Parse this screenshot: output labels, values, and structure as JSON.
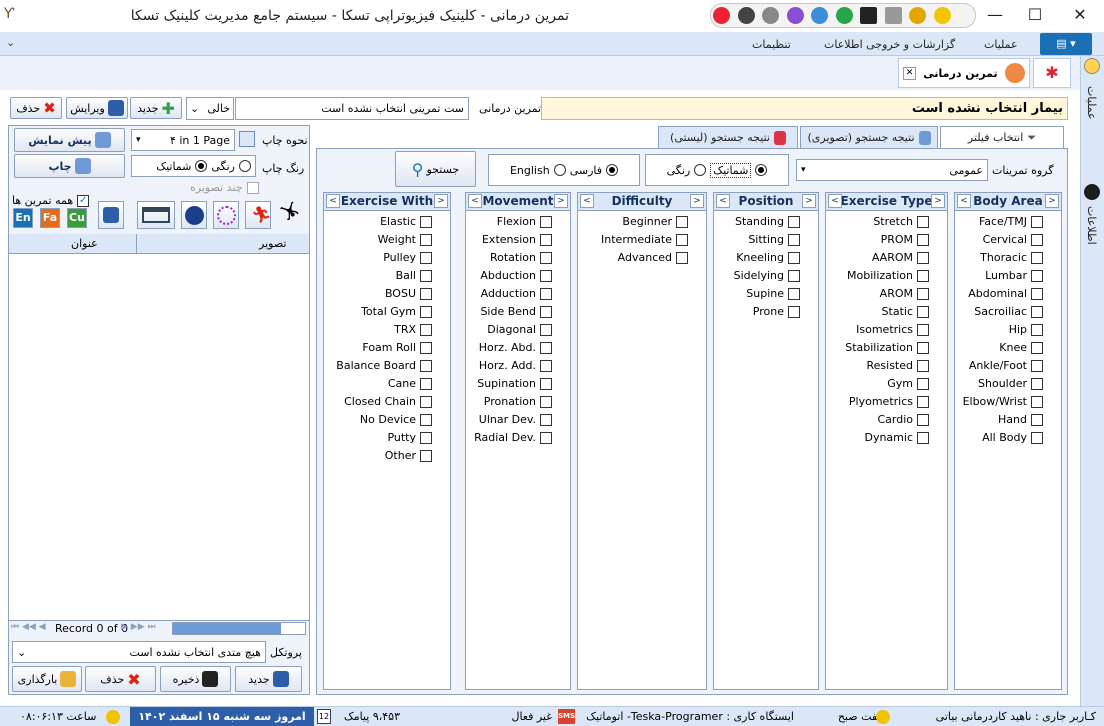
{
  "window": {
    "title": "تمرین درمانی - کلینیک فیزیوتراپی تسکا - سیستم جامع مدیریت کلینیک تسکا",
    "minimize": "—",
    "maximize": "☐",
    "close": "✕"
  },
  "menu": {
    "operations": "عملیات",
    "reports": "گزارشات و خروجی اطلاعات",
    "settings": "تنظیمات"
  },
  "doc_tab": {
    "label": "تمرین درمانی",
    "close": "✕"
  },
  "side_right": {
    "operations": "عملیات",
    "info": "اطلاعات"
  },
  "toolbar": {
    "patient_status": "بیمار انتخاب نشده است",
    "exercise_label": "تمرین درمانی",
    "exercise_value": "ست تمرینی انتخاب نشده است",
    "filter_value": "خالی",
    "new_label": "جدید",
    "edit_label": "ویرایش",
    "delete_label": "حذف"
  },
  "left": {
    "print_mode_label": "نحوه چاپ",
    "print_mode_value": "۴ in 1 Page",
    "preview_button": "پیش نمایش",
    "print_color_label": "رنگ چاپ",
    "color_option": "رنگی",
    "schematic_option": "شماتیک",
    "print_button": "چاپ",
    "multi_image": "چند تصویره",
    "all_exercises": "همه تمرین ها",
    "lang_en": "En",
    "lang_fa": "Fa",
    "lang_cu": "Cu",
    "col_title": "عنوان",
    "col_image": "تصویر",
    "record_text": "Record 0 of 0",
    "protocol_label": "پروتکل",
    "protocol_value": "هیچ متدی انتخاب نشده است",
    "new_btn": "جدید",
    "save_btn": "ذخیره",
    "delete_btn": "حذف",
    "load_btn": "بارگذاری"
  },
  "tabs": {
    "filter": "انتخاب فیلتر",
    "image_result": "(نتیجه جستجو (تصویری",
    "list_result": "(نتیجه جستجو (لیستی"
  },
  "filter": {
    "group_label": "گروه تمرینات",
    "group_value": "عمومی",
    "color_option": "رنگی",
    "schematic_option": "شماتیک",
    "lang_english": "English",
    "lang_farsi": "فارسی",
    "search_button": "جستجو"
  },
  "columns": [
    {
      "title": "Body Area",
      "items": [
        "Face/TMJ",
        "Cervical",
        "Thoracic",
        "Lumbar",
        "Abdominal",
        "Sacroiliac",
        "Hip",
        "Knee",
        "Ankle/Foot",
        "Shoulder",
        "Elbow/Wrist",
        "Hand",
        "All Body"
      ]
    },
    {
      "title": "Exercise Type",
      "items": [
        "Stretch",
        "PROM",
        "AAROM",
        "Mobilization",
        "AROM",
        "Static",
        "Isometrics",
        "Stabilization",
        "Resisted",
        "Gym",
        "Plyometrics",
        "Cardio",
        "Dynamic"
      ]
    },
    {
      "title": "Position",
      "items": [
        "Standing",
        "Sitting",
        "Kneeling",
        "Sidelying",
        "Supine",
        "Prone"
      ]
    },
    {
      "title": "Difficulty",
      "items": [
        "Beginner",
        "Intermediate",
        "Advanced"
      ]
    },
    {
      "title": "Movement",
      "items": [
        "Flexion",
        "Extension",
        "Rotation",
        "Abduction",
        "Adduction",
        "Side Bend",
        "Diagonal",
        "Horz. Abd.",
        "Horz. Add.",
        "Supination",
        "Pronation",
        "Ulnar Dev.",
        "Radial Dev."
      ]
    },
    {
      "title": "Exercise With",
      "items": [
        "Elastic",
        "Weight",
        "Pulley",
        "Ball",
        "BOSU",
        "Total Gym",
        "TRX",
        "Foam Roll",
        "Balance Board",
        "Cane",
        "Closed Chain",
        "No Device",
        "Putty",
        "Other"
      ]
    }
  ],
  "status": {
    "user": "کـاربر جاری : ناهید کاردرمانی بیاتی",
    "shift": "شیفت صبح",
    "station": "ایستگاه کاری : Teska-Programer- اتوماتیک",
    "sms": "غیر فعال",
    "sms_count": "۹،۴۵۳ پیامک",
    "calendar_day": "12",
    "date": "امروز سه شنبه ۱۵ اسفند ۱۴۰۲",
    "time": "ساعت ۰۸:۰۶:۱۳"
  },
  "colors": {
    "accent": "#1a6fb5",
    "panel_border": "#8aa0bd",
    "header_bg": "#dbe7f6",
    "patient_bar": "#fff6dc"
  }
}
